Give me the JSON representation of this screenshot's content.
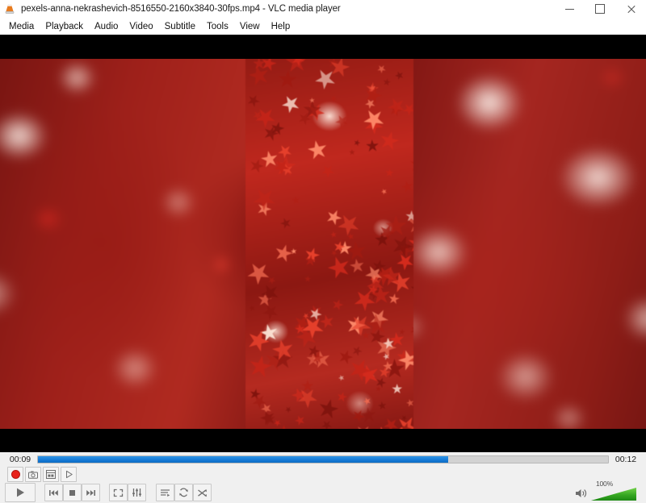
{
  "window": {
    "title": "pexels-anna-nekrashevich-8516550-2160x3840-30fps.mp4 - VLC media player",
    "app_icon": "vlc-cone-icon",
    "minimize_label": "–",
    "maximize_label": "□",
    "close_label": "×"
  },
  "menubar": {
    "items": [
      {
        "label": "Media"
      },
      {
        "label": "Playback"
      },
      {
        "label": "Audio"
      },
      {
        "label": "Video"
      },
      {
        "label": "Subtitle"
      },
      {
        "label": "Tools"
      },
      {
        "label": "View"
      },
      {
        "label": "Help"
      }
    ]
  },
  "video": {
    "description": "Close-up macro video of red star-shaped glitter confetti with shallow depth of field",
    "letterbox_color": "#000000"
  },
  "seekbar": {
    "elapsed": "00:09",
    "remaining": "00:12",
    "progress_percent": 72,
    "fill_color": "#1579d6",
    "track_color": "#d2d2d2"
  },
  "extra_controls": [
    {
      "name": "record-button",
      "icon": "record-icon"
    },
    {
      "name": "snapshot-button",
      "icon": "camera-icon"
    },
    {
      "name": "frame-by-frame-button",
      "icon": "frame-icon"
    },
    {
      "name": "advanced-play-button",
      "icon": "play-outline-icon"
    }
  ],
  "controls": {
    "play": {
      "label": "Play",
      "icon": "play-icon"
    },
    "previous": {
      "label": "Previous",
      "icon": "previous-icon"
    },
    "stop": {
      "label": "Stop",
      "icon": "stop-icon"
    },
    "next": {
      "label": "Next",
      "icon": "next-icon"
    },
    "fullscreen": {
      "label": "Toggle fullscreen",
      "icon": "fullscreen-icon"
    },
    "extended": {
      "label": "Show extended settings",
      "icon": "equalizer-icon"
    },
    "playlist": {
      "label": "Show playlist",
      "icon": "playlist-icon"
    },
    "loop": {
      "label": "Loop",
      "icon": "loop-icon"
    },
    "random": {
      "label": "Random",
      "icon": "shuffle-icon"
    }
  },
  "volume": {
    "label": "100%",
    "level_percent": 100,
    "icon": "speaker-icon",
    "fill_color": "#33a520"
  }
}
